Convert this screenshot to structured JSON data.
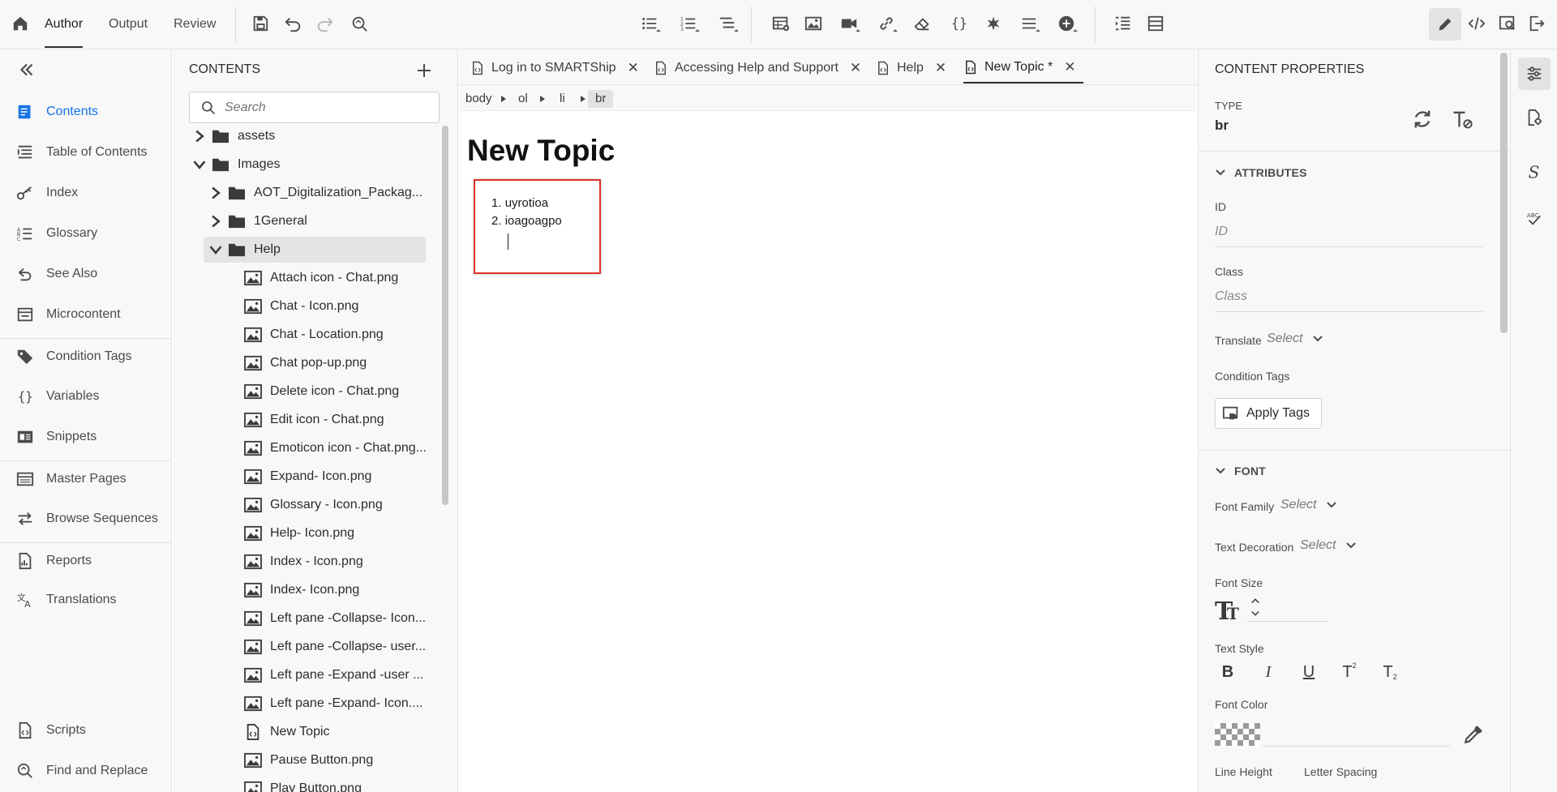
{
  "topbar": {
    "modes": [
      "Author",
      "Output",
      "Review"
    ],
    "icons": [
      "home-icon",
      "save-icon",
      "undo-icon",
      "redo-icon",
      "find-icon",
      "bulleted-list-icon",
      "numbered-list-icon",
      "multilevel-list-icon",
      "insert-table-icon",
      "insert-image-icon",
      "insert-video-icon",
      "insert-link-icon",
      "eraser-icon",
      "variable-icon",
      "special-character-icon",
      "horizontal-rule-icon",
      "insert-more-icon",
      "indent-icon",
      "layout-icon",
      "edit-mode-icon",
      "source-view-icon",
      "preview-icon",
      "exit-icon"
    ]
  },
  "leftnav": {
    "items": [
      "Contents",
      "Table of Contents",
      "Index",
      "Glossary",
      "See Also",
      "Microcontent",
      "Condition Tags",
      "Variables",
      "Snippets",
      "Master Pages",
      "Browse Sequences",
      "Reports",
      "Translations",
      "Scripts",
      "Find and Replace"
    ]
  },
  "contents": {
    "title": "CONTENTS",
    "search_placeholder": "Search",
    "tree": [
      {
        "label": "assets",
        "type": "folder",
        "state": "collapsed"
      },
      {
        "label": "Images",
        "type": "folder",
        "state": "expanded"
      },
      {
        "label": "AOT_Digitalization_Packag...",
        "type": "folder",
        "state": "collapsed"
      },
      {
        "label": "1General",
        "type": "folder",
        "state": "collapsed"
      },
      {
        "label": "Help",
        "type": "folder",
        "state": "expanded"
      },
      {
        "label": "Attach icon - Chat.png",
        "type": "image"
      },
      {
        "label": "Chat - Icon.png",
        "type": "image"
      },
      {
        "label": "Chat - Location.png",
        "type": "image"
      },
      {
        "label": "Chat pop-up.png",
        "type": "image"
      },
      {
        "label": "Delete icon - Chat.png",
        "type": "image"
      },
      {
        "label": "Edit icon - Chat.png",
        "type": "image"
      },
      {
        "label": "Emoticon icon - Chat.png...",
        "type": "image"
      },
      {
        "label": "Expand- Icon.png",
        "type": "image"
      },
      {
        "label": "Glossary - Icon.png",
        "type": "image"
      },
      {
        "label": "Help- Icon.png",
        "type": "image"
      },
      {
        "label": "Index - Icon.png",
        "type": "image"
      },
      {
        "label": "Index- Icon.png",
        "type": "image"
      },
      {
        "label": "Left pane -Collapse- Icon....",
        "type": "image"
      },
      {
        "label": "Left pane -Collapse- user...",
        "type": "image"
      },
      {
        "label": "Left pane -Expand -user ...",
        "type": "image"
      },
      {
        "label": "Left pane -Expand- Icon....",
        "type": "image"
      },
      {
        "label": "New Topic",
        "type": "topic"
      },
      {
        "label": "Pause Button.png",
        "type": "image"
      },
      {
        "label": "Play Button.png",
        "type": "image"
      }
    ]
  },
  "editor": {
    "tabs": [
      {
        "label": "Log in to SMARTShip"
      },
      {
        "label": "Accessing Help and Support"
      },
      {
        "label": "Help"
      },
      {
        "label": "New Topic *"
      }
    ],
    "breadcrumb": [
      "body",
      "ol",
      "li",
      "br"
    ],
    "heading": "New Topic",
    "list": [
      "uyrotioa",
      "ioagoagpo"
    ]
  },
  "props": {
    "title": "CONTENT PROPERTIES",
    "type_label": "TYPE",
    "type_value": "br",
    "attributes_header": "ATTRIBUTES",
    "id_label": "ID",
    "id_placeholder": "ID",
    "class_label": "Class",
    "class_placeholder": "Class",
    "translate_label": "Translate",
    "select": "Select",
    "condition_tags_label": "Condition Tags",
    "apply_tags": "Apply Tags",
    "font_header": "FONT",
    "font_family_label": "Font Family",
    "text_decoration_label": "Text Decoration",
    "font_size_label": "Font Size",
    "text_style_label": "Text Style",
    "font_color_label": "Font Color",
    "line_height_label": "Line Height",
    "letter_spacing_label": "Letter Spacing",
    "style_buttons": [
      "B",
      "I",
      "U",
      "T",
      "T"
    ]
  },
  "colors": {
    "accent": "#1473e6",
    "highlight_border": "#e0322b"
  }
}
